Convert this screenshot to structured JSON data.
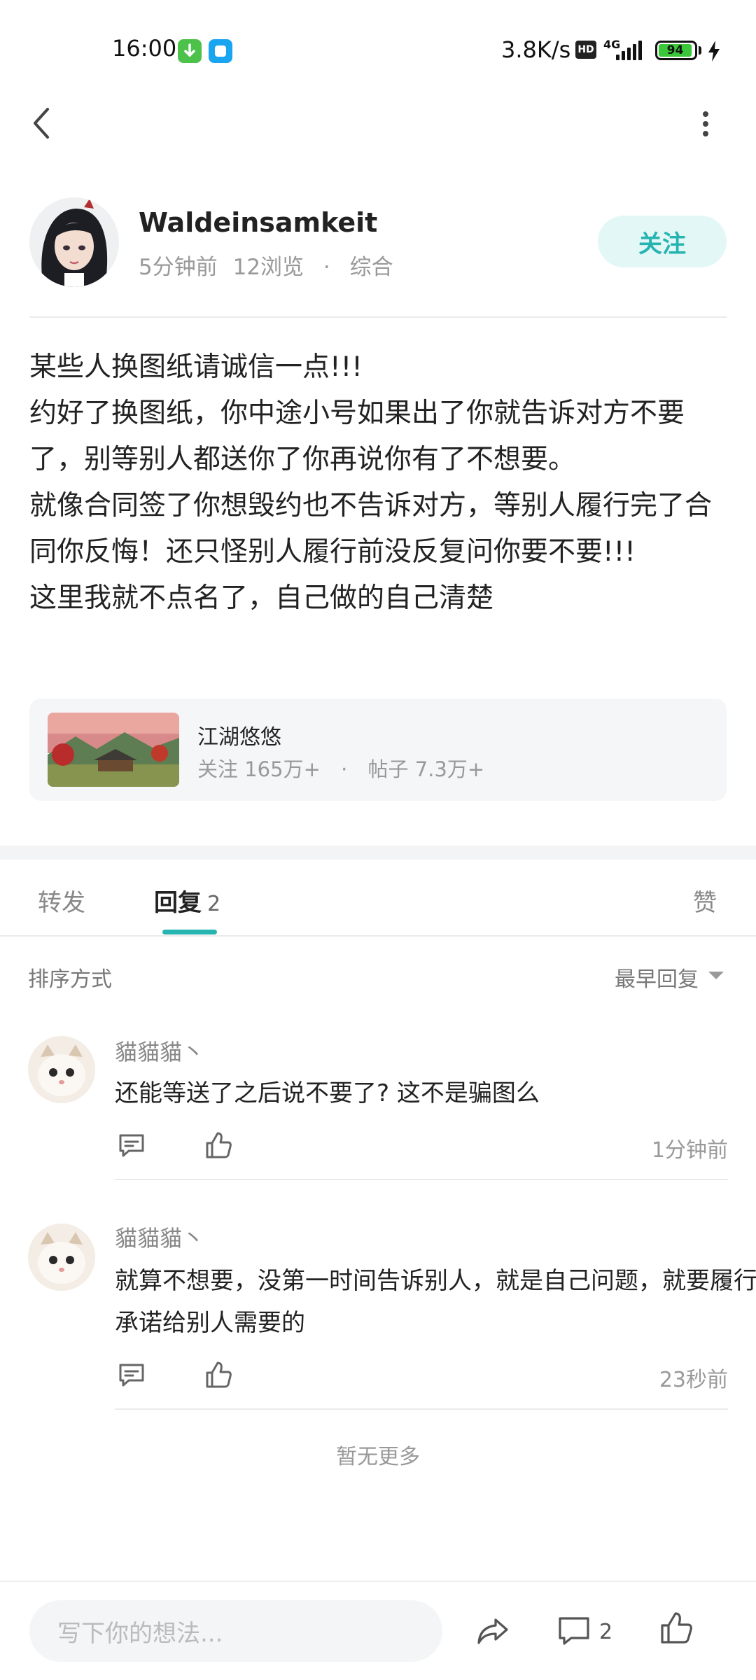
{
  "status_bar": {
    "time": "16:00",
    "net_speed": "3.8K/s",
    "hd_label": "HD",
    "network_type": "4G",
    "battery_level": "94"
  },
  "author": {
    "name": "Waldeinsamkeit",
    "time": "5分钟前",
    "views": "12浏览",
    "separator": "·",
    "category": "综合",
    "follow_label": "关注"
  },
  "post": {
    "lines": [
      "某些人换图纸请诚信一点!!!",
      "约好了换图纸，你中途小号如果出了你就告诉对方不要了，别等别人都送你了你再说你有了不想要。",
      "就像合同签了你想毁约也不告诉对方，等别人履行完了合同你反悔！还只怪别人履行前没反复问你要不要!!!",
      "这里我就不点名了，自己做的自己清楚"
    ]
  },
  "forum": {
    "name": "江湖悠悠",
    "followers": "关注 165万+",
    "separator": "·",
    "posts": "帖子 7.3万+"
  },
  "tabs": {
    "forward": "转发",
    "reply": "回复",
    "reply_count": "2",
    "like": "赞"
  },
  "sort": {
    "label": "排序方式",
    "value": "最早回复"
  },
  "comments": [
    {
      "name": "貓貓貓丶",
      "text": "还能等送了之后说不要了? 这不是骗图么",
      "time": "1分钟前"
    },
    {
      "name": "貓貓貓丶",
      "text": "就算不想要，没第一时间告诉别人，就是自己问题，就要履行承诺给别人需要的",
      "time": "23秒前"
    }
  ],
  "no_more": "暂无更多",
  "bottom_bar": {
    "input_placeholder": "写下你的想法...",
    "comment_count": "2"
  },
  "colors": {
    "accent": "#26b4b0",
    "follow_bg": "#e3f7f6"
  }
}
